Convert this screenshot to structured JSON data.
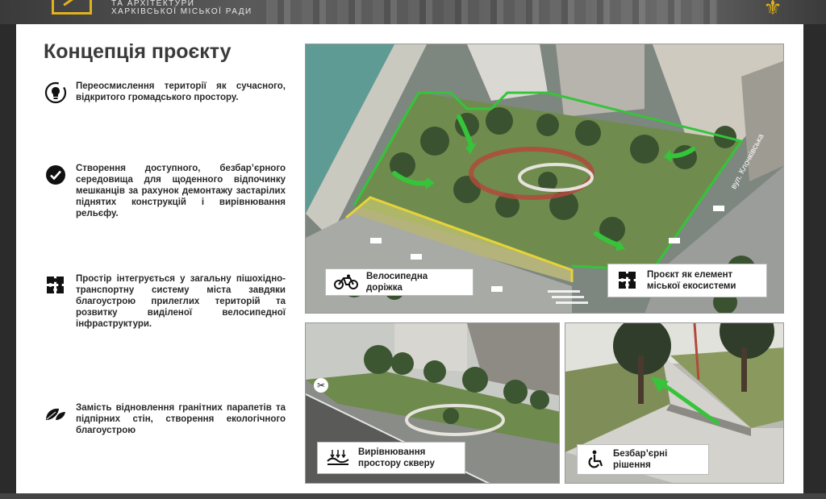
{
  "header": {
    "org_line1": "та архітектури",
    "org_line2": "харківської міської ради"
  },
  "slide": {
    "title": "Концепція проєкту",
    "points": [
      {
        "icon": "lightbulb-refresh-icon",
        "text": "Переосмислення території як сучасного, відкритого громадського простору."
      },
      {
        "icon": "check-circle-icon",
        "text": "Створення доступного, безбар’єрного середовища для щоденного відпочинку мешканців за рахунок демонтажу застарілих піднятих конструкцій і вирівнювання рельєфу."
      },
      {
        "icon": "puzzle-icon",
        "text": "Простір інтегрується у загальну пішохідно-транспортну систему міста завдяки благоустрою прилеглих територій та розвитку виділеної велосипедної інфраструктури."
      },
      {
        "icon": "leaves-icon",
        "text": "Замість відновлення гранітних парапетів та підпірних стін, створення екологічного благоустрою"
      }
    ],
    "main_image": {
      "street_label": "вул. Клочківська",
      "caption_bike": "Велосипедна доріжка",
      "caption_eco": "Проєкт як елемент міської екосистеми"
    },
    "bottom_left": {
      "caption": "Вирівнювання простору скверу"
    },
    "bottom_right": {
      "caption": "Безбар’єрні рішення"
    }
  },
  "colors": {
    "accent_green": "#35c43a",
    "bike_yellow": "#e6d23a",
    "header_gold": "#e2b21c"
  }
}
